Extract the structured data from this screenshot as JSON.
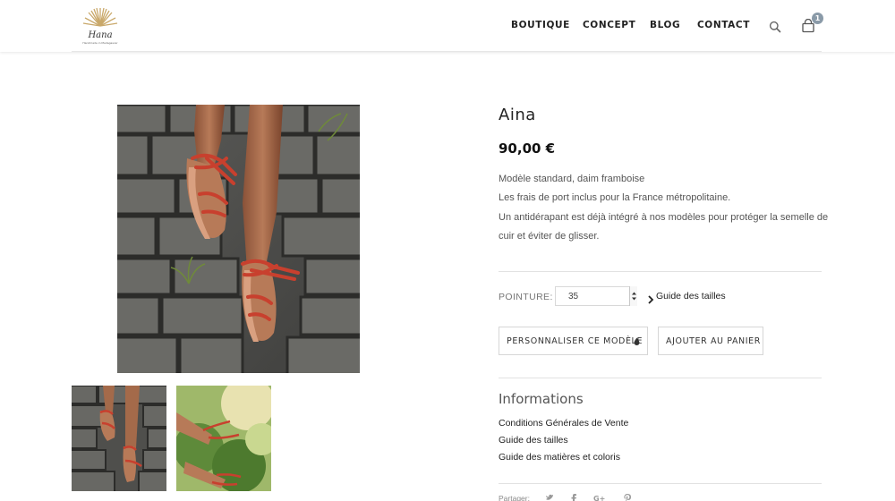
{
  "header": {
    "logo_text": "Hana",
    "logo_subtext": "Handmade in Madagascar",
    "nav": [
      {
        "label": "BOUTIQUE"
      },
      {
        "label": "CONCEPT"
      },
      {
        "label": "BLOG"
      },
      {
        "label": "CONTACT"
      }
    ],
    "cart_count": "1",
    "badge_color": "#8a9aa8"
  },
  "product": {
    "title": "Aina",
    "price": "90,00 €",
    "description": [
      "Modèle standard, daim framboise",
      "Les frais de port inclus pour la France métropolitaine.",
      "Un antidérapant est déjà intégré à nos modèles pour protéger la semelle de",
      "cuir et éviter de glisser."
    ],
    "size_label": "POINTURE:",
    "size_value": "35",
    "size_guide": "Guide des tailles",
    "personalize_button": "PERSONNALISER CE MODÈLE",
    "add_to_cart_button": "AJOUTER AU PANIER"
  },
  "informations": {
    "title": "Informations",
    "links": [
      {
        "label": "Conditions Générales de Vente"
      },
      {
        "label": "Guide des tailles"
      },
      {
        "label": "Guide des matières et coloris"
      }
    ]
  },
  "share": {
    "label": "Partager:",
    "icons": [
      "twitter-icon",
      "facebook-icon",
      "google-plus-icon",
      "pinterest-icon"
    ]
  },
  "colors": {
    "sandal_red": "#c8402e",
    "logo_gold": "#c9a86a"
  }
}
